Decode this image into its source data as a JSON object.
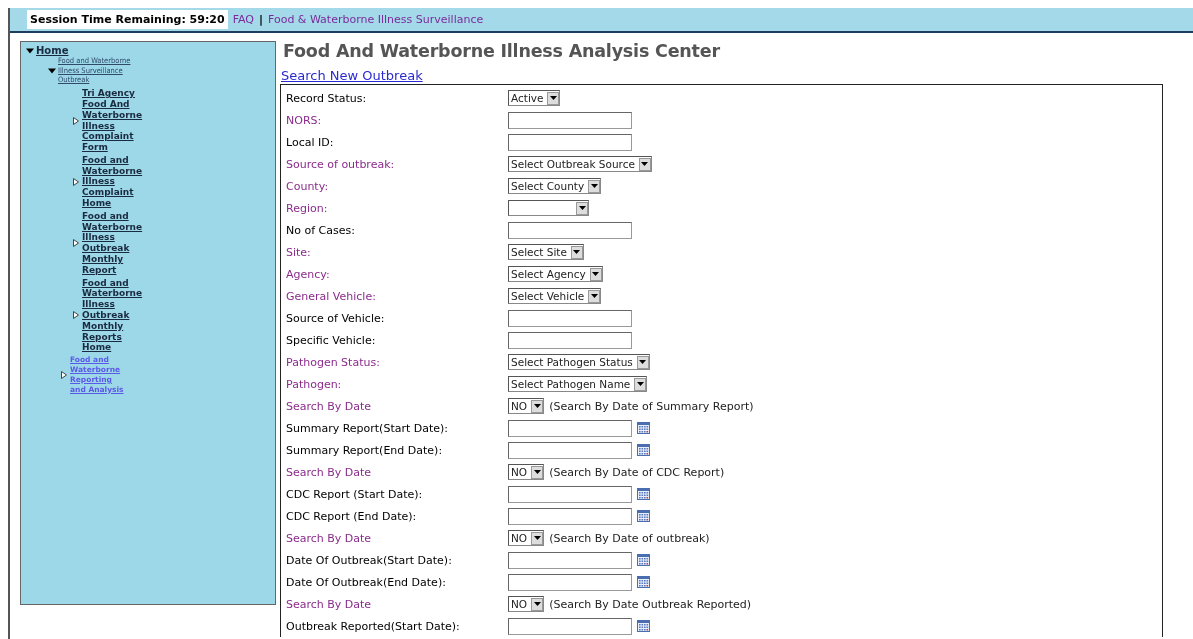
{
  "top_bar": {
    "session": "Session Time Remaining: 59:20",
    "links": [
      {
        "label": "FAQ"
      },
      {
        "label": "Food & Waterborne Illness Surveillance"
      }
    ],
    "separator": "|"
  },
  "sidebar": {
    "tree": [
      {
        "label": "Home",
        "kind": "root",
        "expanded": true,
        "children": [
          {
            "label": "Food and Waterborne Illness Surveillance Outbreak",
            "kind": "small",
            "expanded": true,
            "children": [
              {
                "label": "Tri Agency Food And Waterborne Illness Complaint Form",
                "kind": "strong",
                "expanded": false
              },
              {
                "label": "Food and Waterborne Illness Complaint Home",
                "kind": "strong",
                "expanded": false
              },
              {
                "label": "Food and Waterborne Illness Outbreak Monthly Report",
                "kind": "strong",
                "expanded": false
              },
              {
                "label": "Food and Waterborne Illness Outbreak Monthly Reports Home",
                "kind": "strong",
                "expanded": false
              }
            ]
          },
          {
            "label": "Food and Waterborne Reporting and Analysis",
            "kind": "light",
            "expanded": false
          }
        ]
      }
    ]
  },
  "main": {
    "title": "Food And Waterborne Illness Analysis Center",
    "link": "Search New Outbreak",
    "rows": [
      {
        "label": "Record Status:",
        "color": "#000000",
        "kind": "select",
        "value": "Active"
      },
      {
        "label": "NORS:",
        "color": "#8b2c8b",
        "kind": "text"
      },
      {
        "label": "Local ID:",
        "color": "#000000",
        "kind": "text"
      },
      {
        "label": "Source of outbreak:",
        "color": "#8b2c8b",
        "kind": "select",
        "value": "Select Outbreak Source"
      },
      {
        "label": "County:",
        "color": "#8b2c8b",
        "kind": "select",
        "value": "Select County"
      },
      {
        "label": "Region:",
        "color": "#8b2c8b",
        "kind": "select"
      },
      {
        "label": "No of Cases:",
        "color": "#000000",
        "kind": "text"
      },
      {
        "label": "Site:",
        "color": "#8b2c8b",
        "kind": "select",
        "value": "Select Site"
      },
      {
        "label": "Agency:",
        "color": "#8b2c8b",
        "kind": "select",
        "value": "Select Agency"
      },
      {
        "label": "General Vehicle:",
        "color": "#8b2c8b",
        "kind": "select",
        "value": "Select Vehicle"
      },
      {
        "label": "Source of Vehicle:",
        "color": "#000000",
        "kind": "text"
      },
      {
        "label": "Specific Vehicle:",
        "color": "#000000",
        "kind": "text"
      },
      {
        "label": "Pathogen Status:",
        "color": "#8b2c8b",
        "kind": "select",
        "value": "Select Pathogen Status"
      },
      {
        "label": "Pathogen:",
        "color": "#8b2c8b",
        "kind": "select",
        "value": "Select Pathogen Name"
      },
      {
        "label": "Search By Date",
        "color": "#8b2c8b",
        "kind": "select",
        "value": "NO",
        "note": "(Search By Date of Summary Report)"
      },
      {
        "label": "Summary Report(Start Date):",
        "color": "#000000",
        "kind": "date"
      },
      {
        "label": "Summary Report(End Date):",
        "color": "#000000",
        "kind": "date"
      },
      {
        "label": "Search By Date",
        "color": "#8b2c8b",
        "kind": "select",
        "value": "NO",
        "note": "(Search By Date of CDC Report)"
      },
      {
        "label": "CDC Report (Start Date):",
        "color": "#000000",
        "kind": "date"
      },
      {
        "label": "CDC Report (End Date):",
        "color": "#000000",
        "kind": "date"
      },
      {
        "label": "Search By Date",
        "color": "#8b2c8b",
        "kind": "select",
        "value": "NO",
        "note": "(Search By Date of outbreak)"
      },
      {
        "label": "Date Of Outbreak(Start Date):",
        "color": "#000000",
        "kind": "date"
      },
      {
        "label": "Date Of Outbreak(End Date):",
        "color": "#000000",
        "kind": "date"
      },
      {
        "label": "Search By Date",
        "color": "#8b2c8b",
        "kind": "select",
        "value": "NO",
        "note": "(Search By Date Outbreak Reported)"
      },
      {
        "label": "Outbreak Reported(Start Date):",
        "color": "#000000",
        "kind": "date"
      }
    ]
  }
}
